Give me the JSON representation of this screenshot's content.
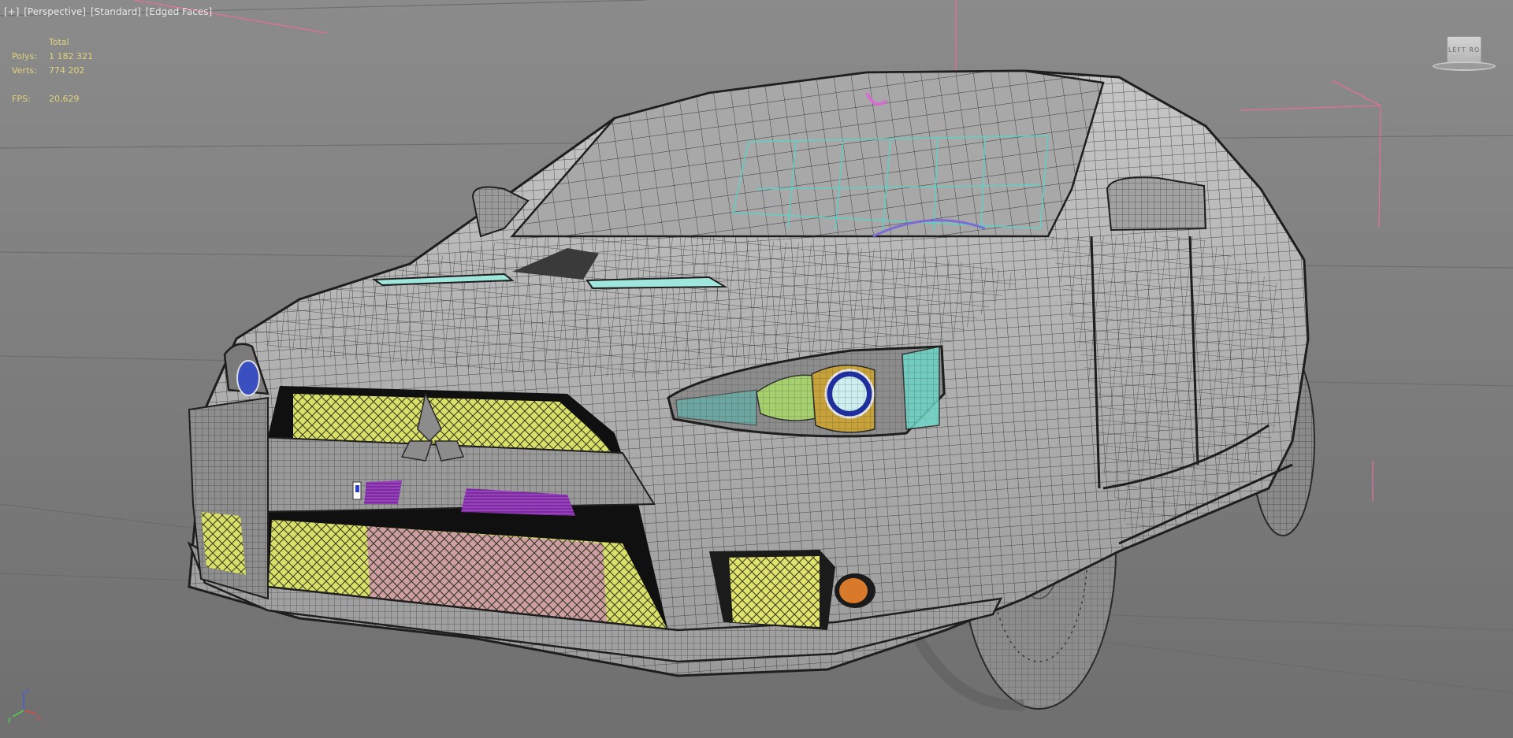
{
  "viewport": {
    "labels": [
      "[+]",
      "[Perspective]",
      "[Standard]",
      "[Edged Faces]"
    ]
  },
  "stats": {
    "header": "Total",
    "polys_label": "Polys:",
    "polys_value": "1 182 321",
    "verts_label": "Verts:",
    "verts_value": "774 202",
    "fps_label": "FPS:",
    "fps_value": "20,629"
  },
  "viewcube": {
    "face_labels": "LEFT  RO"
  },
  "axis_gizmo": {
    "x": "x",
    "y": "y",
    "z": "z"
  },
  "colors": {
    "background": "#808080",
    "wire": "#2a2a2a",
    "body": "#b4b4b4",
    "grille_mesh": "#d8e06a",
    "purple_vent": "#9a3fbf",
    "cyan_glass": "#55d6c8",
    "pink_helper": "#e0709a",
    "fog_light": "#d87a2a",
    "stats_text": "#e0d27a"
  }
}
